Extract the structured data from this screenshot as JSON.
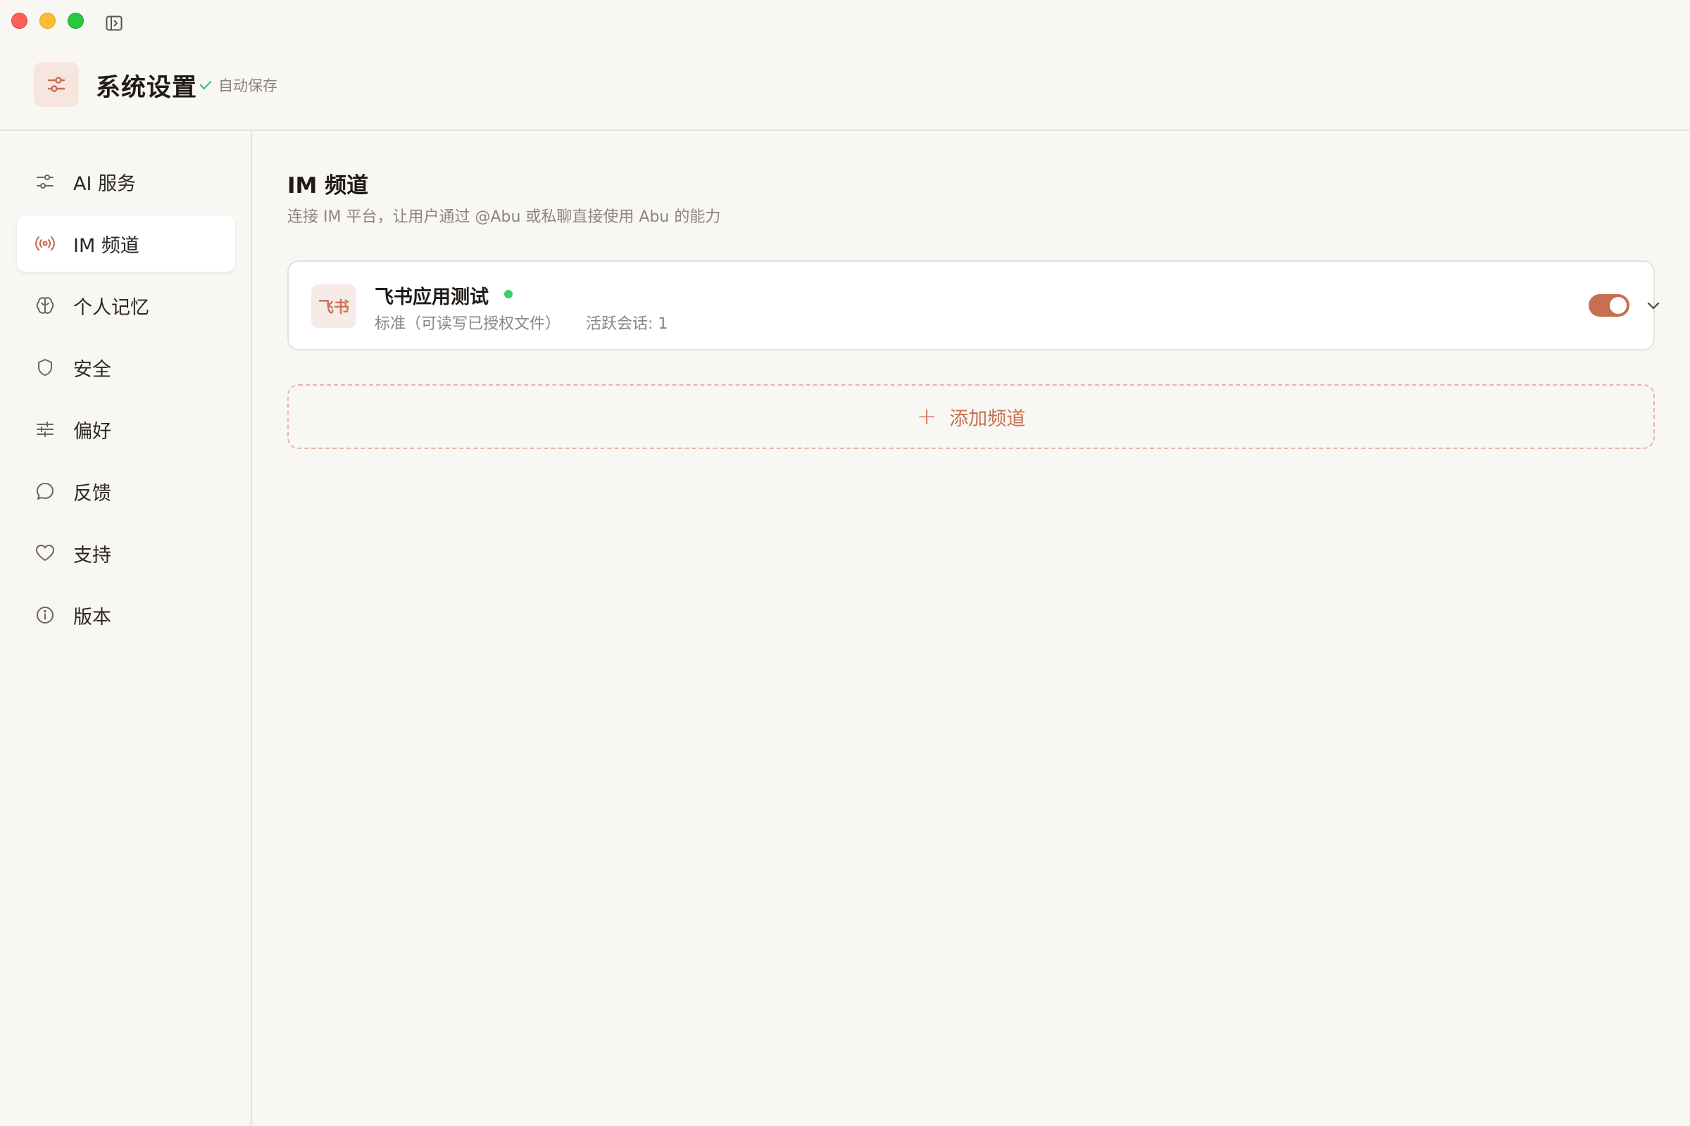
{
  "window": {
    "controls": [
      "close",
      "minimize",
      "maximize"
    ],
    "toolbar_icon": "sidebar-toggle-icon"
  },
  "header": {
    "icon": "sliders-icon",
    "title": "系统设置",
    "autosave_label": "自动保存",
    "autosave_icon": "check-icon"
  },
  "sidebar": {
    "items": [
      {
        "label": "AI 服务",
        "icon": "sliders-icon",
        "active": false
      },
      {
        "label": "IM 频道",
        "icon": "broadcast-icon",
        "active": true
      },
      {
        "label": "个人记忆",
        "icon": "brain-icon",
        "active": false
      },
      {
        "label": "安全",
        "icon": "shield-icon",
        "active": false
      },
      {
        "label": "偏好",
        "icon": "equalizer-icon",
        "active": false
      },
      {
        "label": "反馈",
        "icon": "chat-bubble-icon",
        "active": false
      },
      {
        "label": "支持",
        "icon": "heart-icon",
        "active": false
      },
      {
        "label": "版本",
        "icon": "info-icon",
        "active": false
      }
    ]
  },
  "main": {
    "title": "IM 频道",
    "description": "连接 IM 平台，让用户通过 @Abu 或私聊直接使用 Abu 的能力",
    "channels": [
      {
        "logo_text": "飞书",
        "name": "飞书应用测试",
        "status": "online",
        "permission": "标准（可读写已授权文件）",
        "active_sessions": "活跃会话: 1",
        "enabled": true
      }
    ],
    "add_button": {
      "icon": "+",
      "label": "添加频道"
    }
  },
  "colors": {
    "accent": "#c66f51",
    "online": "#3ecc6e",
    "background": "#f9f7f3"
  }
}
